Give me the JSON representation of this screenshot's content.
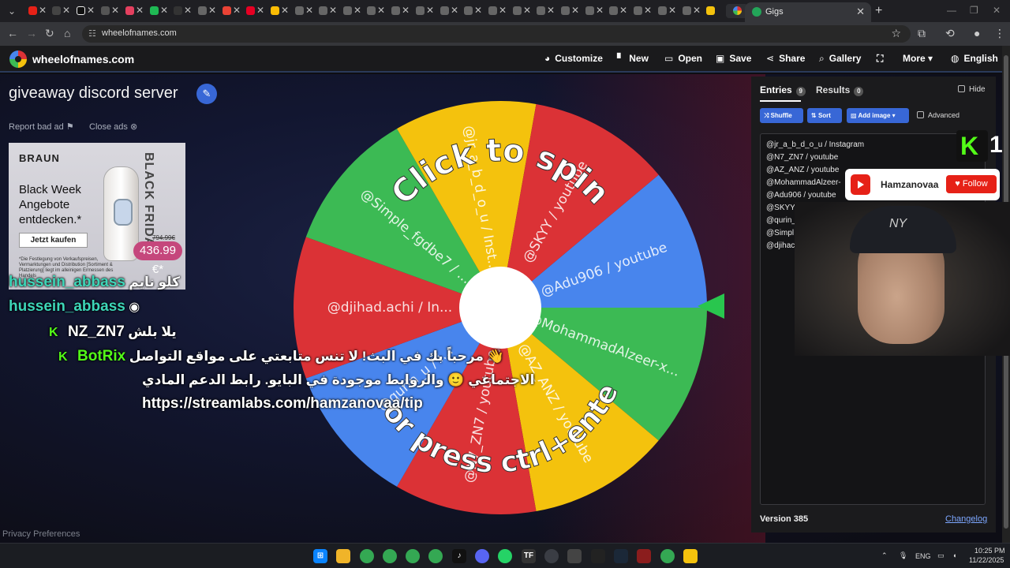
{
  "browser": {
    "active_tab_title": "Gigs",
    "url": "wheelofnames.com"
  },
  "site": {
    "name": "wheelofnames.com",
    "menu": {
      "customize": "Customize",
      "new": "New",
      "open": "Open",
      "save": "Save",
      "share": "Share",
      "gallery": "Gallery",
      "more": "More",
      "language": "English"
    }
  },
  "wheel": {
    "title": "giveaway discord server",
    "report": "Report bad ad",
    "close_ads": "Close ads",
    "center_text_top": "Click to spin",
    "center_text_bottom": "or press ctrl+enter",
    "segment_labels": [
      "@Adu906 / youtube",
      "@MohammadAlzeer-x...",
      "@AZ_ANZ / youtube",
      "@N7_ZN7 / youtube",
      "@qurin_u / i...",
      "@djihad.achi / In...",
      "@Simple_fgdbe7 / ...",
      "@jr_a_b_d_o_u / Inst...",
      "@SKYY / youtube"
    ],
    "segment_colors": [
      "#4885ed",
      "#3cba54",
      "#f4c20d",
      "#db3236",
      "#4885ed",
      "#db3236",
      "#3cba54",
      "#f4c20d",
      "#db3236"
    ]
  },
  "ad": {
    "brand": "BRAUN",
    "headline": "Black Week Angebote entdecken.*",
    "cta": "Jetzt kaufen",
    "fine_print": "*Die Festlegung von Verkaufspreisen, Vermarktungen und Distribution [Sortiment & Platzierung] liegt im alleinigen Ermessen des Handels",
    "vertical": "BLACK FRIDAY",
    "old_price": "794.99€",
    "price": "436.99 €*"
  },
  "chat": [
    {
      "user": "hussein_abbass",
      "text": "كلو نايم"
    },
    {
      "user": "hussein_abbass",
      "text": ""
    },
    {
      "user": "NZ_ZN7",
      "text": "يلا بلش"
    },
    {
      "user": "BotRix",
      "text": "مرحباً بك في البث! لا تنس متابعتي على مواقع التواصل 👋"
    },
    {
      "user": "",
      "text": "الاجتماعي 🙂 والروابط موجودة في البايو. رابط الدعم المادي"
    },
    {
      "user": "",
      "text": "https://streamlabs.com/hamzanovaa/tip"
    }
  ],
  "panel": {
    "entries_tab": "Entries",
    "entries_count": "9",
    "results_tab": "Results",
    "results_count": "0",
    "hide": "Hide",
    "shuffle": "Shuffle",
    "sort": "Sort",
    "add_image": "Add image",
    "advanced": "Advanced",
    "entries": [
      "@jr_a_b_d_o_u / Instagram",
      "@N7_ZN7 / youtube",
      "@AZ_ANZ / youtube",
      "@MohammadAlzeer-",
      "@Adu906 / youtube",
      "@SKYY-",
      "@qurin_",
      "@Simpl",
      "@djihac"
    ],
    "version": "Version 385",
    "changelog": "Changelog"
  },
  "stream": {
    "kick_badge_count": "1",
    "yt_name": "Hamzanovaa",
    "follow": "Follow",
    "cap_logo": "NY"
  },
  "footer": {
    "privacy": "Privacy Preferences"
  },
  "taskbar": {
    "lang": "ENG",
    "time": "10:25 PM",
    "date": "11/22/2025"
  }
}
